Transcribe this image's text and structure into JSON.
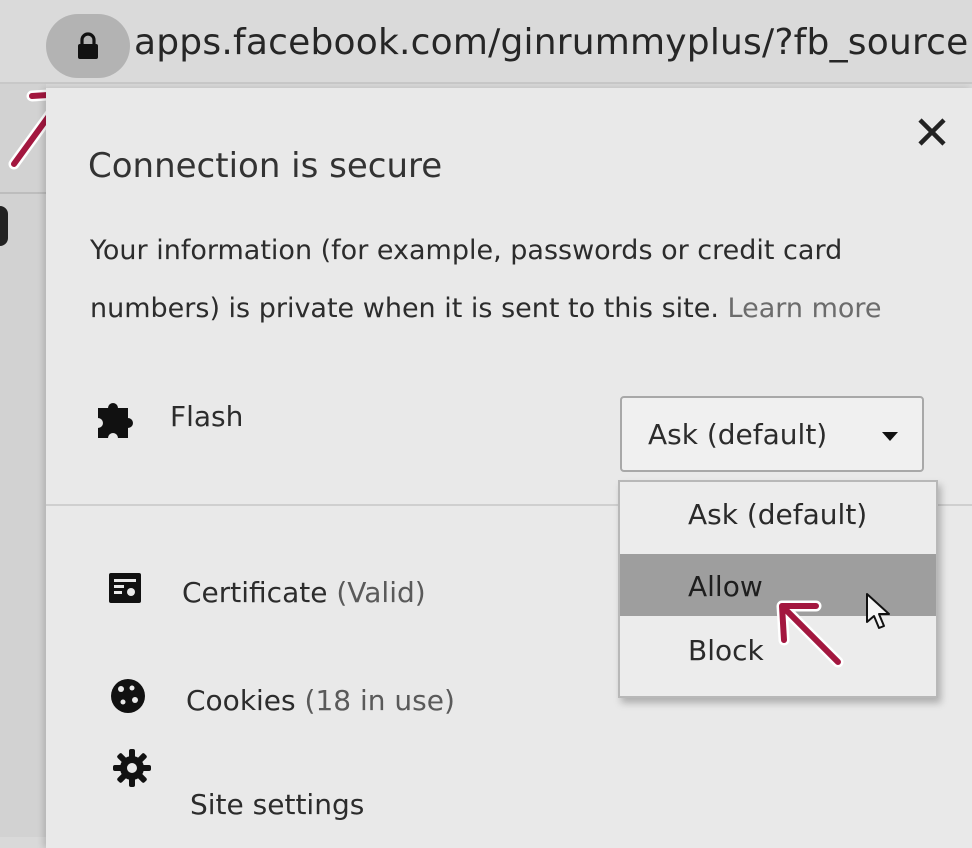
{
  "address_bar": {
    "url": "apps.facebook.com/ginrummyplus/?fb_source",
    "lock_icon": "lock-icon"
  },
  "popup": {
    "title": "Connection is secure",
    "description": "Your information (for example, passwords or credit card numbers) is private when it is sent to this site.",
    "learn_more": "Learn more",
    "close_icon": "close-icon",
    "flash": {
      "icon": "puzzle-piece-icon",
      "label": "Flash",
      "selected_value": "Ask (default)",
      "options": [
        "Ask (default)",
        "Allow",
        "Block"
      ],
      "highlighted_option": "Allow"
    },
    "rows": [
      {
        "icon": "certificate-icon",
        "label": "Certificate",
        "detail": "(Valid)"
      },
      {
        "icon": "cookie-icon",
        "label": "Cookies",
        "detail": "(18 in use)"
      },
      {
        "icon": "gear-icon",
        "label": "Site settings",
        "detail": ""
      }
    ]
  },
  "annotations": {
    "arrow_color": "#a3173f"
  }
}
